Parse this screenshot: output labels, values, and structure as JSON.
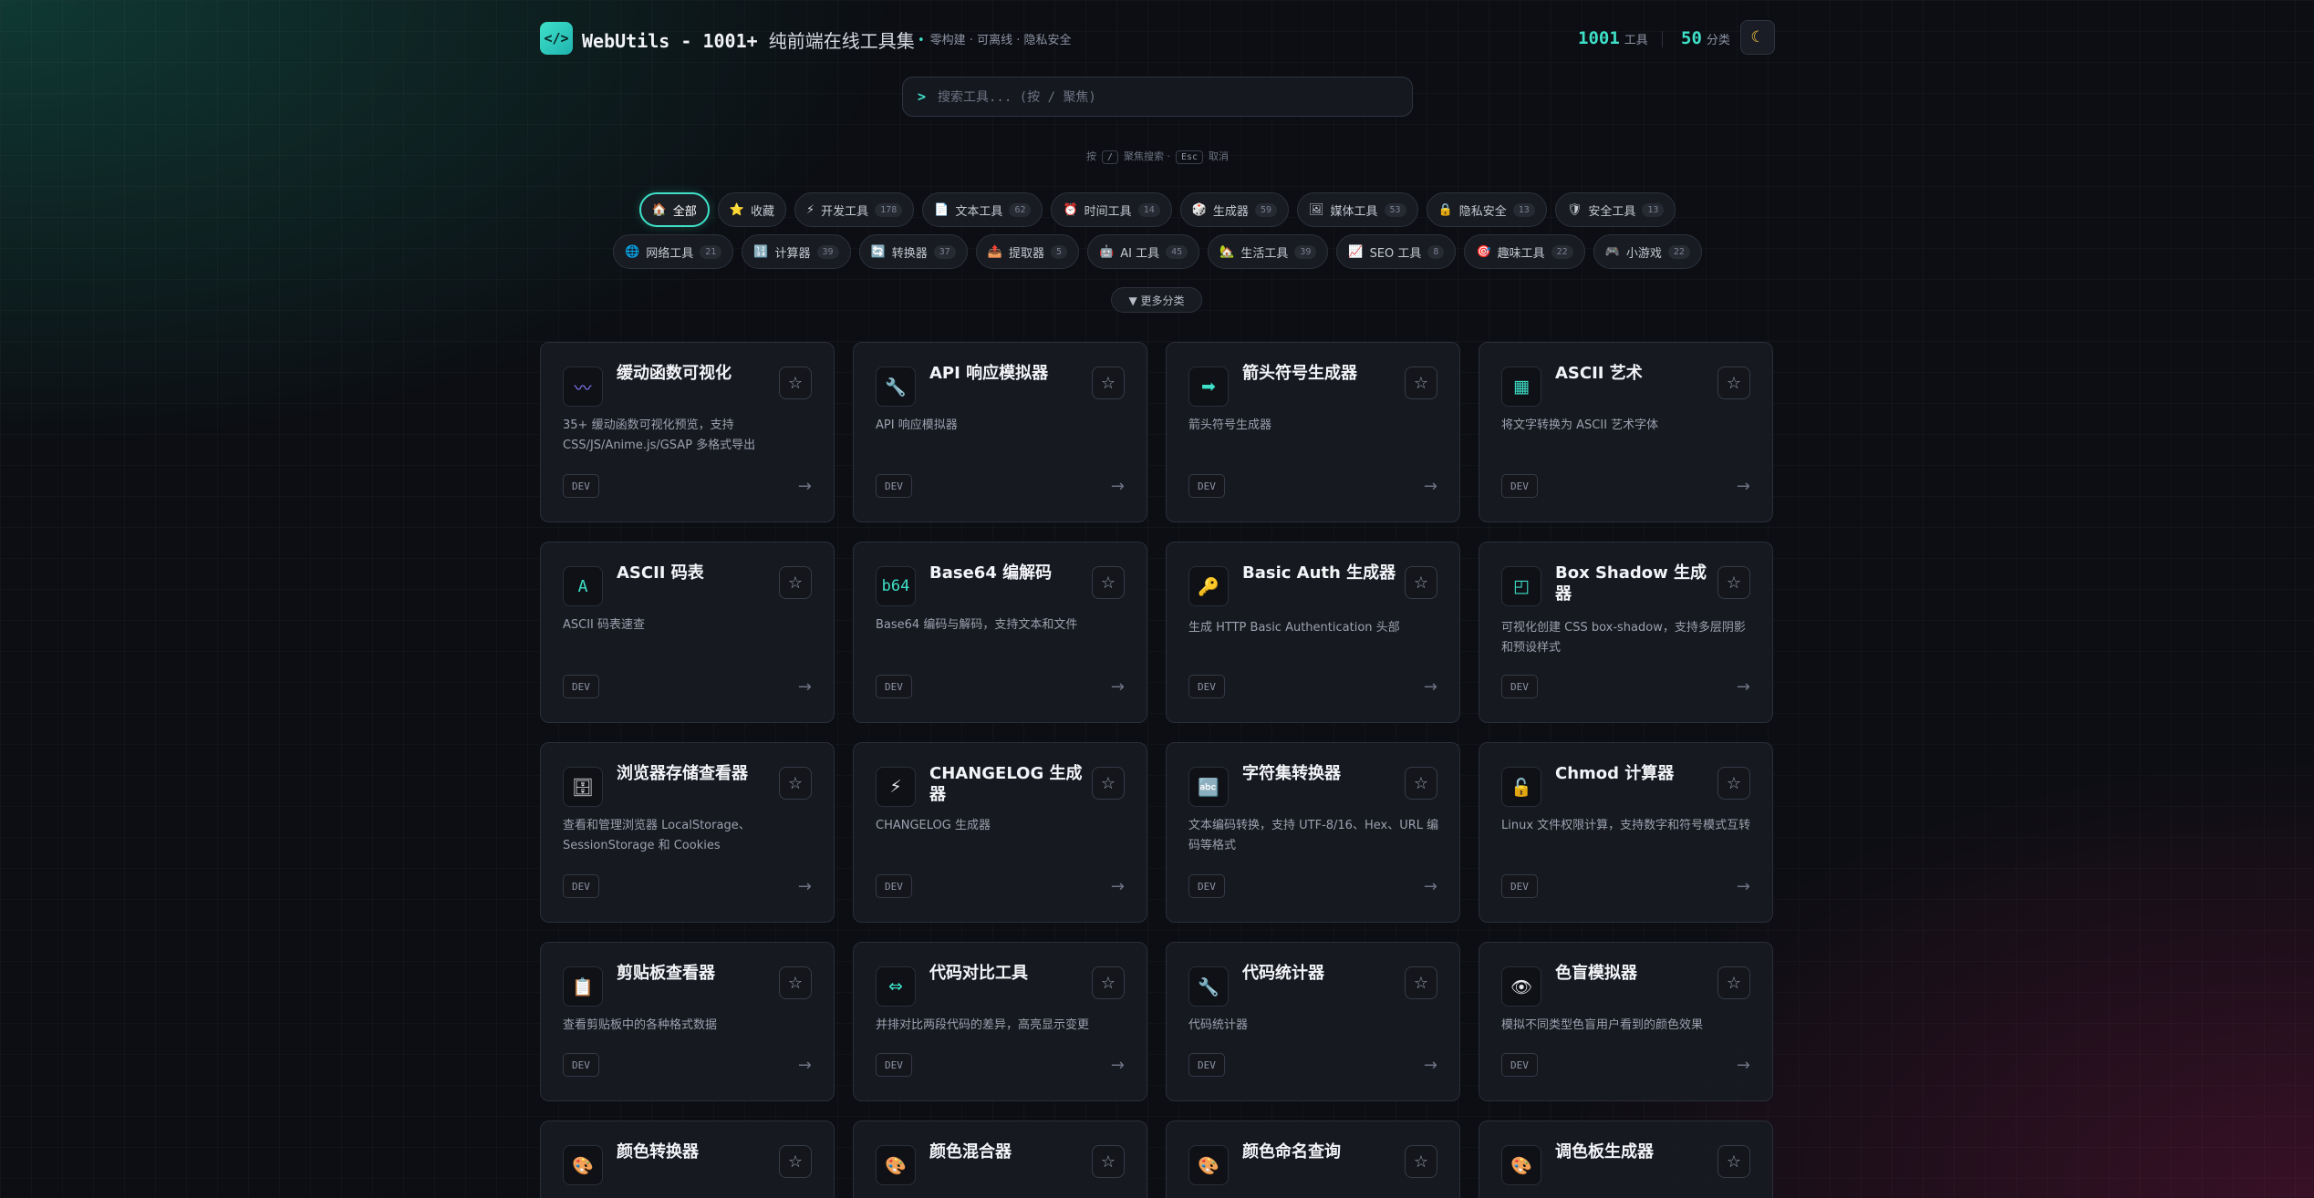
{
  "header": {
    "logo": "</>",
    "title_prefix": "WebUtils - 1001+ ",
    "title_cn": "纯前端在线工具集",
    "tagline": "零构建 · 可离线 · 隐私安全",
    "tools_count": "1001",
    "tools_label": "工具",
    "categories_count": "50",
    "categories_label": "分类",
    "theme_icon": "☾"
  },
  "search": {
    "prompt": ">",
    "placeholder": "搜索工具... (按 / 聚焦)"
  },
  "hint": {
    "press": "按",
    "key1": "/",
    "focus": "聚焦搜索 ·",
    "key2": "Esc",
    "cancel": "取消"
  },
  "chips_row1": [
    {
      "icon": "🏠",
      "label": "全部",
      "count": ""
    },
    {
      "icon": "⭐",
      "label": "收藏",
      "count": ""
    },
    {
      "icon": "⚡",
      "label": "开发工具",
      "count": "178"
    },
    {
      "icon": "📄",
      "label": "文本工具",
      "count": "62"
    },
    {
      "icon": "⏰",
      "label": "时间工具",
      "count": "14"
    },
    {
      "icon": "🎲",
      "label": "生成器",
      "count": "59"
    },
    {
      "icon": "🖼",
      "label": "媒体工具",
      "count": "53"
    },
    {
      "icon": "🔒",
      "label": "隐私安全",
      "count": "13"
    },
    {
      "icon": "🛡",
      "label": "安全工具",
      "count": "13"
    }
  ],
  "chips_row2": [
    {
      "icon": "🌐",
      "label": "网络工具",
      "count": "21"
    },
    {
      "icon": "🔢",
      "label": "计算器",
      "count": "39"
    },
    {
      "icon": "🔄",
      "label": "转换器",
      "count": "37"
    },
    {
      "icon": "📤",
      "label": "提取器",
      "count": "5"
    },
    {
      "icon": "🤖",
      "label": "AI 工具",
      "count": "45"
    },
    {
      "icon": "🏡",
      "label": "生活工具",
      "count": "39"
    },
    {
      "icon": "📈",
      "label": "SEO 工具",
      "count": "8"
    },
    {
      "icon": "🎯",
      "label": "趣味工具",
      "count": "22"
    },
    {
      "icon": "🎮",
      "label": "小游戏",
      "count": "22"
    }
  ],
  "more_button": "▼ 更多分类",
  "cards": [
    {
      "icon": "〰",
      "title": "缓动函数可视化",
      "desc": "35+ 缓动函数可视化预览，支持 CSS/JS/Anime.js/GSAP 多格式导出",
      "tag": "DEV"
    },
    {
      "icon": "🔧",
      "title": "API 响应模拟器",
      "desc": "API 响应模拟器",
      "tag": "DEV"
    },
    {
      "icon": "➡",
      "title": "箭头符号生成器",
      "desc": "箭头符号生成器",
      "tag": "DEV"
    },
    {
      "icon": "▦",
      "title": "ASCII 艺术",
      "desc": "将文字转换为 ASCII 艺术字体",
      "tag": "DEV"
    },
    {
      "icon": "A",
      "title": "ASCII 码表",
      "desc": "ASCII 码表速查",
      "tag": "DEV"
    },
    {
      "icon": "b64",
      "title": "Base64 编解码",
      "desc": "Base64 编码与解码，支持文本和文件",
      "tag": "DEV"
    },
    {
      "icon": "🔑",
      "title": "Basic Auth 生成器",
      "desc": "生成 HTTP Basic Authentication 头部",
      "tag": "DEV"
    },
    {
      "icon": "◰",
      "title": "Box Shadow 生成器",
      "desc": "可视化创建 CSS box-shadow，支持多层阴影和预设样式",
      "tag": "DEV"
    },
    {
      "icon": "🗄",
      "title": "浏览器存储查看器",
      "desc": "查看和管理浏览器 LocalStorage、SessionStorage 和 Cookies",
      "tag": "DEV"
    },
    {
      "icon": "⚡",
      "title": "CHANGELOG 生成器",
      "desc": "CHANGELOG 生成器",
      "tag": "DEV"
    },
    {
      "icon": "🔤",
      "title": "字符集转换器",
      "desc": "文本编码转换，支持 UTF-8/16、Hex、URL 编码等格式",
      "tag": "DEV"
    },
    {
      "icon": "🔓",
      "title": "Chmod 计算器",
      "desc": "Linux 文件权限计算，支持数字和符号模式互转",
      "tag": "DEV"
    },
    {
      "icon": "📋",
      "title": "剪贴板查看器",
      "desc": "查看剪贴板中的各种格式数据",
      "tag": "DEV"
    },
    {
      "icon": "⇔",
      "title": "代码对比工具",
      "desc": "并排对比两段代码的差异，高亮显示变更",
      "tag": "DEV"
    },
    {
      "icon": "🔧",
      "title": "代码统计器",
      "desc": "代码统计器",
      "tag": "DEV"
    },
    {
      "icon": "👁",
      "title": "色盲模拟器",
      "desc": "模拟不同类型色盲用户看到的颜色效果",
      "tag": "DEV"
    },
    {
      "icon": "🎨",
      "title": "颜色转换器",
      "desc": "",
      "tag": ""
    },
    {
      "icon": "🎨",
      "title": "颜色混合器",
      "desc": "",
      "tag": ""
    },
    {
      "icon": "🎨",
      "title": "颜色命名查询",
      "desc": "",
      "tag": ""
    },
    {
      "icon": "🎨",
      "title": "调色板生成器",
      "desc": "",
      "tag": ""
    }
  ],
  "card_star": "☆",
  "card_arrow": "→",
  "colors": {
    "accent": "#3ee0c8",
    "background": "#0c0e13"
  }
}
